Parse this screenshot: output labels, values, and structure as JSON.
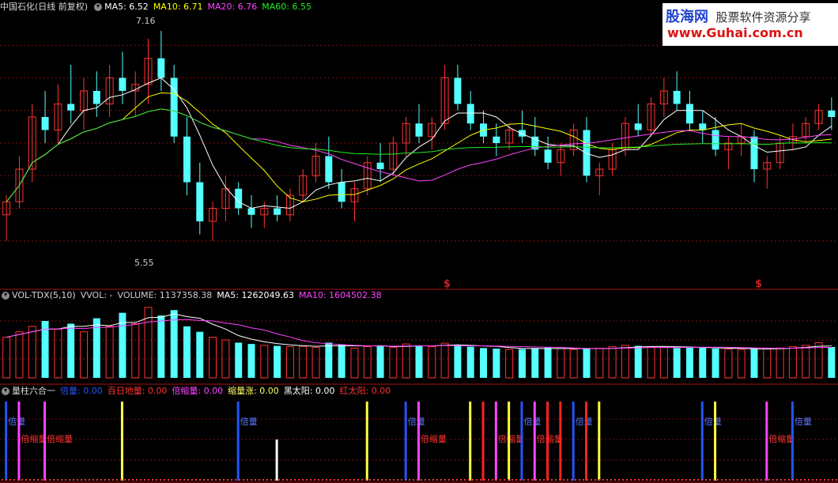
{
  "main": {
    "title": "中国石化(日线 前复权)",
    "ma": [
      {
        "label": "MA5: 6.52",
        "color": "#ffffff"
      },
      {
        "label": "MA10: 6.71",
        "color": "#ffff00"
      },
      {
        "label": "MA20: 6.76",
        "color": "#ff44ff"
      },
      {
        "label": "MA60: 6.55",
        "color": "#22ee22"
      }
    ],
    "high_label": "7.16",
    "low_label": "5.55",
    "markers": [
      "$",
      "$"
    ]
  },
  "volume": {
    "title": "VOL-TDX(5,10)",
    "items": [
      {
        "label": "VVOL: -",
        "color": "#cccccc"
      },
      {
        "label": "VOLUME: 1137358.38",
        "color": "#cccccc"
      },
      {
        "label": "MA5: 1262049.63",
        "color": "#ffffff"
      },
      {
        "label": "MA10: 1604502.38",
        "color": "#ff44ff"
      }
    ]
  },
  "indicator": {
    "title": "量柱六合一",
    "items": [
      {
        "label": "倍量: 0.00",
        "color": "#2255ff"
      },
      {
        "label": "百日地量: 0.00",
        "color": "#ff3333"
      },
      {
        "label": "倍缩量: 0.00",
        "color": "#ff44ff"
      },
      {
        "label": "缩量涨: 0.00",
        "color": "#ffff66"
      },
      {
        "label": "黑太阳: 0.00",
        "color": "#ffffff"
      },
      {
        "label": "红太阳: 0.00",
        "color": "#ff3333"
      }
    ],
    "bar_labels": {
      "double": "倍量",
      "shrink": "倍缩量"
    }
  },
  "logo": {
    "name": "股海网",
    "tagline": "股票软件资源分享",
    "url": "www.Guhai.com.cn"
  },
  "colors": {
    "up": "#ff3333",
    "down": "#54ffff",
    "ma5": "#ffffff",
    "ma10": "#ffff00",
    "ma20": "#ff44ff",
    "ma60": "#22ee22",
    "grid": "#7a1010"
  },
  "chart_data": {
    "type": "candlestick",
    "price_ylim": [
      5.3,
      7.3
    ],
    "candles": [
      [
        5.75,
        5.9,
        5.55,
        5.85
      ],
      [
        5.85,
        6.2,
        5.8,
        6.1
      ],
      [
        6.1,
        6.6,
        6.0,
        6.5
      ],
      [
        6.5,
        6.7,
        6.3,
        6.4
      ],
      [
        6.4,
        6.75,
        6.3,
        6.6
      ],
      [
        6.6,
        6.9,
        6.45,
        6.55
      ],
      [
        6.55,
        6.8,
        6.4,
        6.7
      ],
      [
        6.7,
        6.85,
        6.5,
        6.6
      ],
      [
        6.6,
        6.9,
        6.5,
        6.8
      ],
      [
        6.8,
        7.0,
        6.6,
        6.7
      ],
      [
        6.7,
        6.85,
        6.5,
        6.75
      ],
      [
        6.75,
        7.1,
        6.6,
        6.95
      ],
      [
        6.95,
        7.16,
        6.7,
        6.8
      ],
      [
        6.8,
        6.9,
        6.3,
        6.35
      ],
      [
        6.35,
        6.5,
        5.9,
        6.0
      ],
      [
        6.0,
        6.15,
        5.6,
        5.7
      ],
      [
        5.7,
        5.85,
        5.55,
        5.8
      ],
      [
        5.8,
        6.05,
        5.7,
        5.95
      ],
      [
        5.95,
        6.0,
        5.75,
        5.8
      ],
      [
        5.8,
        5.9,
        5.65,
        5.75
      ],
      [
        5.75,
        5.85,
        5.65,
        5.8
      ],
      [
        5.8,
        5.9,
        5.7,
        5.75
      ],
      [
        5.75,
        5.95,
        5.7,
        5.9
      ],
      [
        5.9,
        6.1,
        5.85,
        6.05
      ],
      [
        6.05,
        6.3,
        6.0,
        6.2
      ],
      [
        6.2,
        6.35,
        5.95,
        6.0
      ],
      [
        6.0,
        6.1,
        5.8,
        5.85
      ],
      [
        5.85,
        6.0,
        5.7,
        5.95
      ],
      [
        5.95,
        6.2,
        5.9,
        6.15
      ],
      [
        6.15,
        6.3,
        6.0,
        6.1
      ],
      [
        6.1,
        6.35,
        6.05,
        6.3
      ],
      [
        6.3,
        6.5,
        6.2,
        6.45
      ],
      [
        6.45,
        6.6,
        6.3,
        6.35
      ],
      [
        6.35,
        6.5,
        6.25,
        6.45
      ],
      [
        6.45,
        6.9,
        6.4,
        6.8
      ],
      [
        6.8,
        6.9,
        6.55,
        6.6
      ],
      [
        6.6,
        6.7,
        6.4,
        6.45
      ],
      [
        6.45,
        6.55,
        6.3,
        6.35
      ],
      [
        6.35,
        6.45,
        6.2,
        6.3
      ],
      [
        6.3,
        6.45,
        6.25,
        6.4
      ],
      [
        6.4,
        6.55,
        6.3,
        6.35
      ],
      [
        6.35,
        6.5,
        6.2,
        6.25
      ],
      [
        6.25,
        6.35,
        6.1,
        6.15
      ],
      [
        6.15,
        6.3,
        6.05,
        6.25
      ],
      [
        6.25,
        6.45,
        6.2,
        6.4
      ],
      [
        6.4,
        6.5,
        6.0,
        6.05
      ],
      [
        6.05,
        6.15,
        5.9,
        6.1
      ],
      [
        6.1,
        6.3,
        6.05,
        6.25
      ],
      [
        6.25,
        6.5,
        6.2,
        6.45
      ],
      [
        6.45,
        6.6,
        6.35,
        6.4
      ],
      [
        6.4,
        6.65,
        6.35,
        6.6
      ],
      [
        6.6,
        6.8,
        6.5,
        6.7
      ],
      [
        6.7,
        6.85,
        6.55,
        6.6
      ],
      [
        6.6,
        6.7,
        6.4,
        6.45
      ],
      [
        6.45,
        6.55,
        6.3,
        6.4
      ],
      [
        6.4,
        6.5,
        6.2,
        6.25
      ],
      [
        6.25,
        6.35,
        6.1,
        6.3
      ],
      [
        6.3,
        6.45,
        6.2,
        6.35
      ],
      [
        6.35,
        6.4,
        6.0,
        6.1
      ],
      [
        6.1,
        6.2,
        5.95,
        6.15
      ],
      [
        6.15,
        6.35,
        6.1,
        6.3
      ],
      [
        6.3,
        6.45,
        6.25,
        6.35
      ],
      [
        6.35,
        6.5,
        6.3,
        6.45
      ],
      [
        6.45,
        6.6,
        6.4,
        6.55
      ],
      [
        6.55,
        6.65,
        6.4,
        6.5
      ]
    ],
    "volume_ylim": [
      0,
      2800000
    ],
    "volumes": [
      1500000,
      1700000,
      1900000,
      2100000,
      1800000,
      2000000,
      1700000,
      2200000,
      1900000,
      2400000,
      2000000,
      2600000,
      2300000,
      2500000,
      1900000,
      1700000,
      1500000,
      1400000,
      1300000,
      1250000,
      1200000,
      1180000,
      1150000,
      1160000,
      1120000,
      1300000,
      1220000,
      1100000,
      1150000,
      1180000,
      1130000,
      1250000,
      1200000,
      1150000,
      1280000,
      1210000,
      1150000,
      1100000,
      1080000,
      1050000,
      1060000,
      1100000,
      1120000,
      1080000,
      1050000,
      1070000,
      1090000,
      1150000,
      1200000,
      1180000,
      1150000,
      1120000,
      1100000,
      1130000,
      1110000,
      1080000,
      1060000,
      1050000,
      1070000,
      1090000,
      1100000,
      1150000,
      1200000,
      1300000,
      1137358
    ],
    "signals": [
      {
        "i": 0,
        "type": "double"
      },
      {
        "i": 1,
        "type": "shrink"
      },
      {
        "i": 3,
        "type": "shrink"
      },
      {
        "i": 9,
        "type": "yellow"
      },
      {
        "i": 18,
        "type": "double"
      },
      {
        "i": 21,
        "type": "white"
      },
      {
        "i": 28,
        "type": "yellow"
      },
      {
        "i": 31,
        "type": "double"
      },
      {
        "i": 32,
        "type": "shrink"
      },
      {
        "i": 36,
        "type": "yellow"
      },
      {
        "i": 37,
        "type": "red"
      },
      {
        "i": 38,
        "type": "shrink"
      },
      {
        "i": 39,
        "type": "yellow"
      },
      {
        "i": 40,
        "type": "double"
      },
      {
        "i": 41,
        "type": "shrink"
      },
      {
        "i": 42,
        "type": "red"
      },
      {
        "i": 43,
        "type": "red"
      },
      {
        "i": 44,
        "type": "double"
      },
      {
        "i": 45,
        "type": "red"
      },
      {
        "i": 46,
        "type": "yellow"
      },
      {
        "i": 54,
        "type": "double"
      },
      {
        "i": 55,
        "type": "yellow"
      },
      {
        "i": 59,
        "type": "shrink"
      },
      {
        "i": 61,
        "type": "double"
      }
    ]
  }
}
